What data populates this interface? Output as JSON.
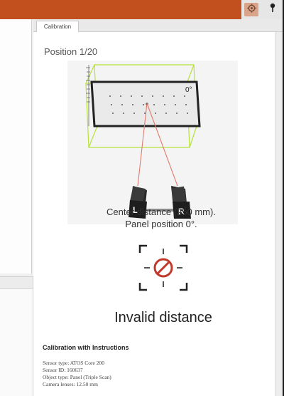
{
  "tab": {
    "label": "Calibration"
  },
  "calibration": {
    "position_label": "Position 1/20",
    "panel_angle_label": "0°",
    "camera_left_label": "L",
    "camera_right_label": "R",
    "caption_line1": "Center distance (250 mm).",
    "caption_line2": "Panel position 0°.",
    "status": "Invalid distance"
  },
  "info": {
    "title": "Calibration with Instructions",
    "lines": [
      "Sensor type: ATOS Core 200",
      "Sensor ID: 160637",
      "Object type: Panel (Triple Scan)",
      "Camera lenses: 12.50 mm"
    ]
  },
  "colors": {
    "title_bar": "#c24f1e",
    "bounding_box": "#b7e23a",
    "beam": "#e07a6a",
    "prohibited": "#c0392b"
  },
  "icons": {
    "settings": "gear-icon",
    "pin": "pin-icon",
    "status": "prohibited-icon"
  }
}
